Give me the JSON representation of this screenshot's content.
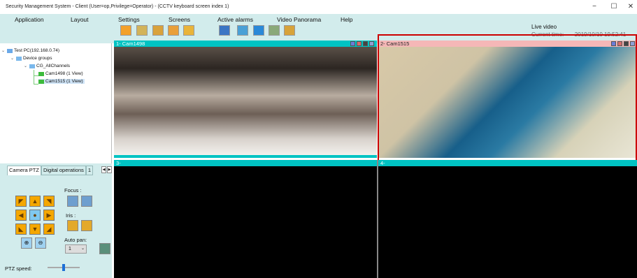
{
  "window": {
    "title": "Security Management System - Client (User=op,Privilege=Operator) - (CCTV keyboard screen index 1)",
    "controls": {
      "minimize": "−",
      "maximize": "☐",
      "close": "✕"
    }
  },
  "menu": {
    "items": [
      "Application",
      "Layout",
      "Settings",
      "Screens",
      "Active alarms",
      "Video Panorama",
      "Help"
    ]
  },
  "toolbar": {
    "layout_buttons": [
      {
        "name": "layout-1x1-button",
        "color": "#f3a12a"
      },
      {
        "name": "layout-2x2-button",
        "color": "#d2b35a"
      },
      {
        "name": "layout-3x3-button",
        "color": "#d9a23c"
      },
      {
        "name": "layout-1plus5-button",
        "color": "#e9a03a"
      },
      {
        "name": "layout-4x4-button",
        "color": "#e9b43a"
      }
    ],
    "action_buttons": [
      {
        "name": "play-button",
        "color": "#3b76c4"
      },
      {
        "name": "snapshot-button",
        "color": "#4aa0d6"
      },
      {
        "name": "search-button",
        "color": "#2a89d8"
      },
      {
        "name": "settings-button",
        "color": "#8aa97a"
      },
      {
        "name": "record-button",
        "color": "#d7a33a"
      }
    ]
  },
  "status": {
    "live_label": "Live video",
    "time_label": "Current time:",
    "time_value": "2019/10/10 19:52:41"
  },
  "tree": {
    "root": "Test PC(192.168.0.74)",
    "group": "Device groups",
    "subgroup": "CG_AllChannels",
    "cameras": [
      "Cam1498 (1 View)",
      "Cam1515 (1 View)"
    ]
  },
  "ptz": {
    "tabs": [
      "Camera PTZ",
      "Digital operations",
      "1"
    ],
    "focus_label": "Focus :",
    "iris_label": "Iris :",
    "autopan_label": "Auto pan:",
    "autopan_value": "1",
    "speed_label": "PTZ speed:",
    "speed_level": 0.5,
    "directions": [
      "◤",
      "▲",
      "◥",
      "◀",
      "●",
      "▶",
      "◣",
      "▼",
      "◢"
    ]
  },
  "views": [
    {
      "label": "1- Cam1498",
      "header_color": "#00c3c3"
    },
    {
      "label": "2- Cam1515",
      "header_color": "#f5b7b7"
    },
    {
      "label": "3-",
      "header_color": "#00c3c3"
    },
    {
      "label": "4-",
      "header_color": "#00c3c3"
    }
  ],
  "colors": {
    "panel_bg": "#d2ecec",
    "selected_border": "#cc0000",
    "view_header": "#00c3c3",
    "selected_header": "#f5b7b7"
  }
}
